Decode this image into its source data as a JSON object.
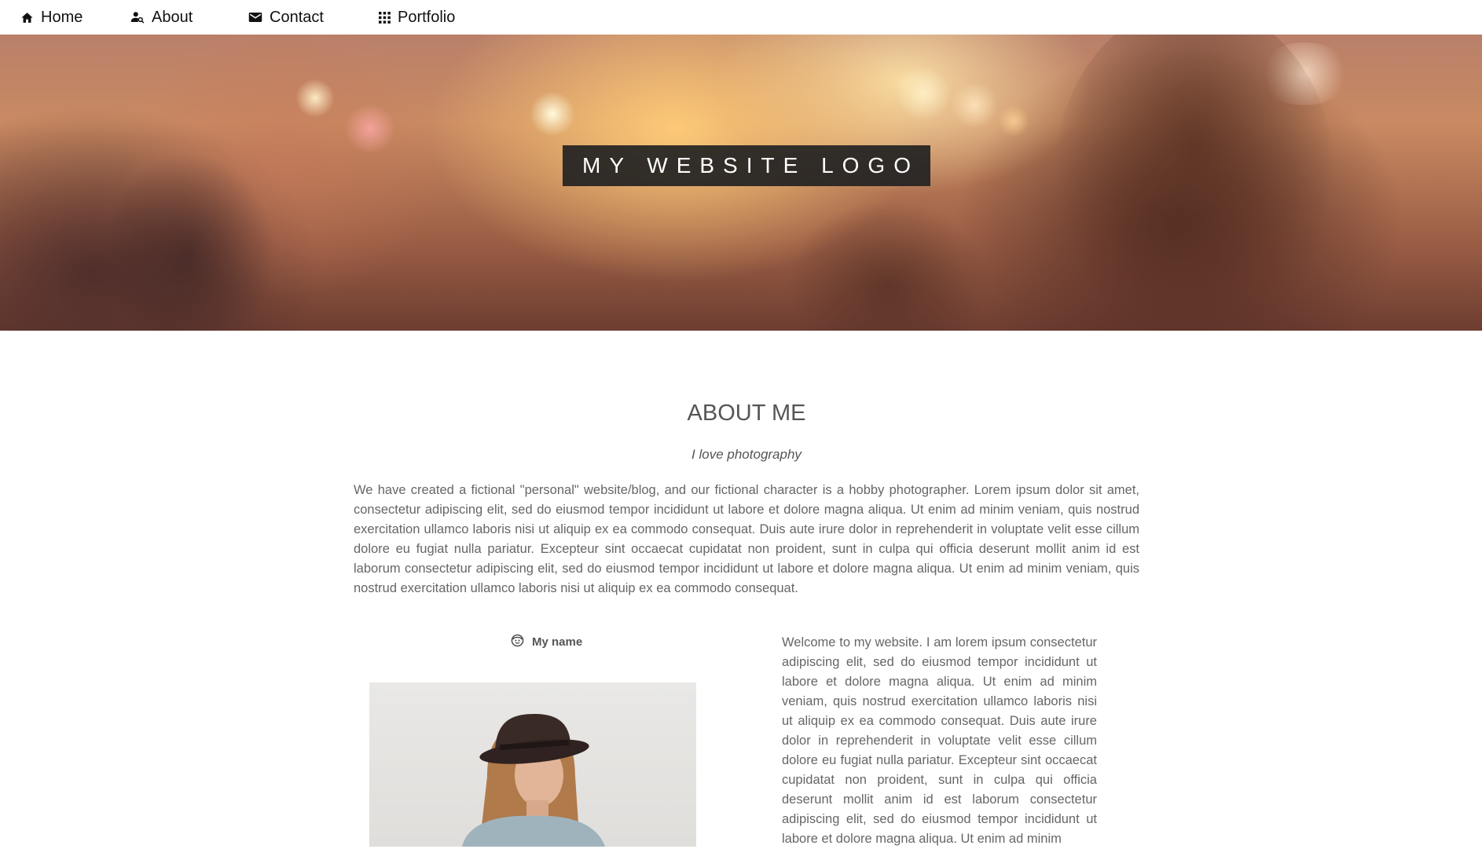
{
  "nav": {
    "items": [
      {
        "label": "Home",
        "icon": "home-icon"
      },
      {
        "label": "About",
        "icon": "user-search-icon"
      },
      {
        "label": "Contact",
        "icon": "mail-icon"
      },
      {
        "label": "Portfolio",
        "icon": "grid-icon"
      }
    ]
  },
  "hero": {
    "logo_text": "MY WEBSITE LOGO"
  },
  "about": {
    "title": "ABOUT ME",
    "subtitle": "I love photography",
    "paragraph": "We have created a fictional \"personal\" website/blog, and our fictional character is a hobby photographer. Lorem ipsum dolor sit amet, consectetur adipiscing elit, sed do eiusmod tempor incididunt ut labore et dolore magna aliqua. Ut enim ad minim veniam, quis nostrud exercitation ullamco laboris nisi ut aliquip ex ea commodo consequat. Duis aute irure dolor in reprehenderit in voluptate velit esse cillum dolore eu fugiat nulla pariatur. Excepteur sint occaecat cupidatat non proident, sunt in culpa qui officia deserunt mollit anim id est laborum consectetur adipiscing elit, sed do eiusmod tempor incididunt ut labore et dolore magna aliqua. Ut enim ad minim veniam, quis nostrud exercitation ullamco laboris nisi ut aliquip ex ea commodo consequat.",
    "name_label": "My name",
    "name_icon": "smiley-icon",
    "welcome": "Welcome to my website. I am lorem ipsum consectetur adipiscing elit, sed do eiusmod tempor incididunt ut labore et dolore magna aliqua. Ut enim ad minim veniam, quis nostrud exercitation ullamco laboris nisi ut aliquip ex ea commodo consequat. Duis aute irure dolor in reprehenderit in voluptate velit esse cillum dolore eu fugiat nulla pariatur. Excepteur sint occaecat cupidatat non proident, sunt in culpa qui officia deserunt mollit anim id est laborum consectetur adipiscing elit, sed do eiusmod tempor incididunt ut labore et dolore magna aliqua. Ut enim ad minim"
  },
  "colors": {
    "logo_bg": "#222222",
    "heading": "#555555",
    "body_text": "#666666"
  }
}
